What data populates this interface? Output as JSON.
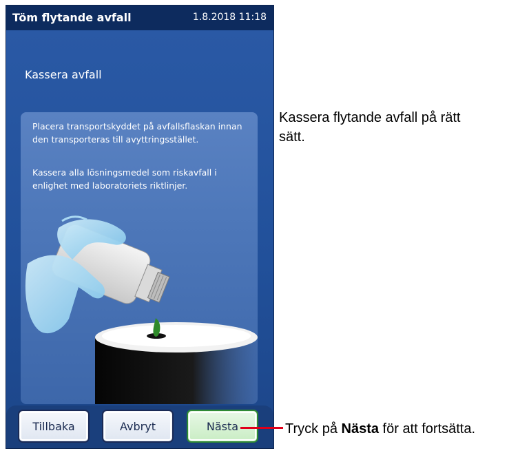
{
  "window": {
    "title": "Töm flytande avfall",
    "datetime": "1.8.2018 11:18"
  },
  "screen": {
    "heading": "Kassera avfall",
    "instruction_1": "Placera transportskyddet på avfallsflaskan innan den transporteras till avyttringsstället.",
    "instruction_2": "Kassera alla lösningsmedel som riskavfall i enlighet med laboratoriets riktlinjer."
  },
  "buttons": {
    "back": "Tillbaka",
    "cancel": "Avbryt",
    "next": "Nästa"
  },
  "annotations": {
    "top": "Kassera flytande avfall på rätt sätt.",
    "bottom_prefix": "Tryck på ",
    "bottom_bold": "Nästa",
    "bottom_suffix": " för att fortsätta."
  },
  "colors": {
    "titlebar": "#0d2b5e",
    "screen": "#21509a",
    "panel": "#4e78ba",
    "next_button_border": "#2f8a34",
    "leader_line": "#e0001a",
    "waste_liquid": "#2e8a2a"
  },
  "icons": {
    "illustration": "pouring-waste-bottle-into-barrel"
  }
}
